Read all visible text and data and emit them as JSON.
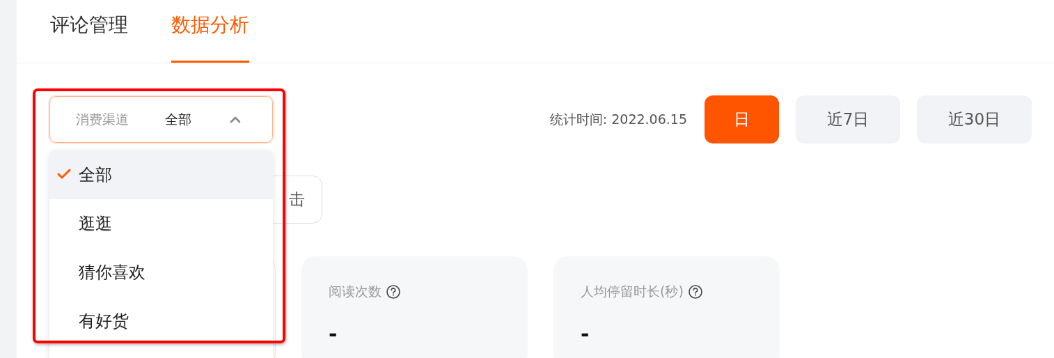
{
  "tabs": [
    {
      "label": "评论管理",
      "selected": false
    },
    {
      "label": "数据分析",
      "selected": true
    }
  ],
  "channel_filter": {
    "label": "消费渠道",
    "value": "全部",
    "expanded": true,
    "options": [
      {
        "label": "全部",
        "selected": true
      },
      {
        "label": "逛逛",
        "selected": false
      },
      {
        "label": "猜你喜欢",
        "selected": false
      },
      {
        "label": "有好货",
        "selected": false
      }
    ]
  },
  "stat_time": "统计时间: 2022.06.15",
  "ranges": [
    {
      "label": "日",
      "selected": true
    },
    {
      "label": "近7日",
      "selected": false
    },
    {
      "label": "近30日",
      "selected": false
    }
  ],
  "metric_button": {
    "label": "击"
  },
  "metrics": [
    {
      "title": "阅读次数",
      "value": "-"
    },
    {
      "title": "人均停留时长(秒)",
      "value": "-"
    }
  ]
}
